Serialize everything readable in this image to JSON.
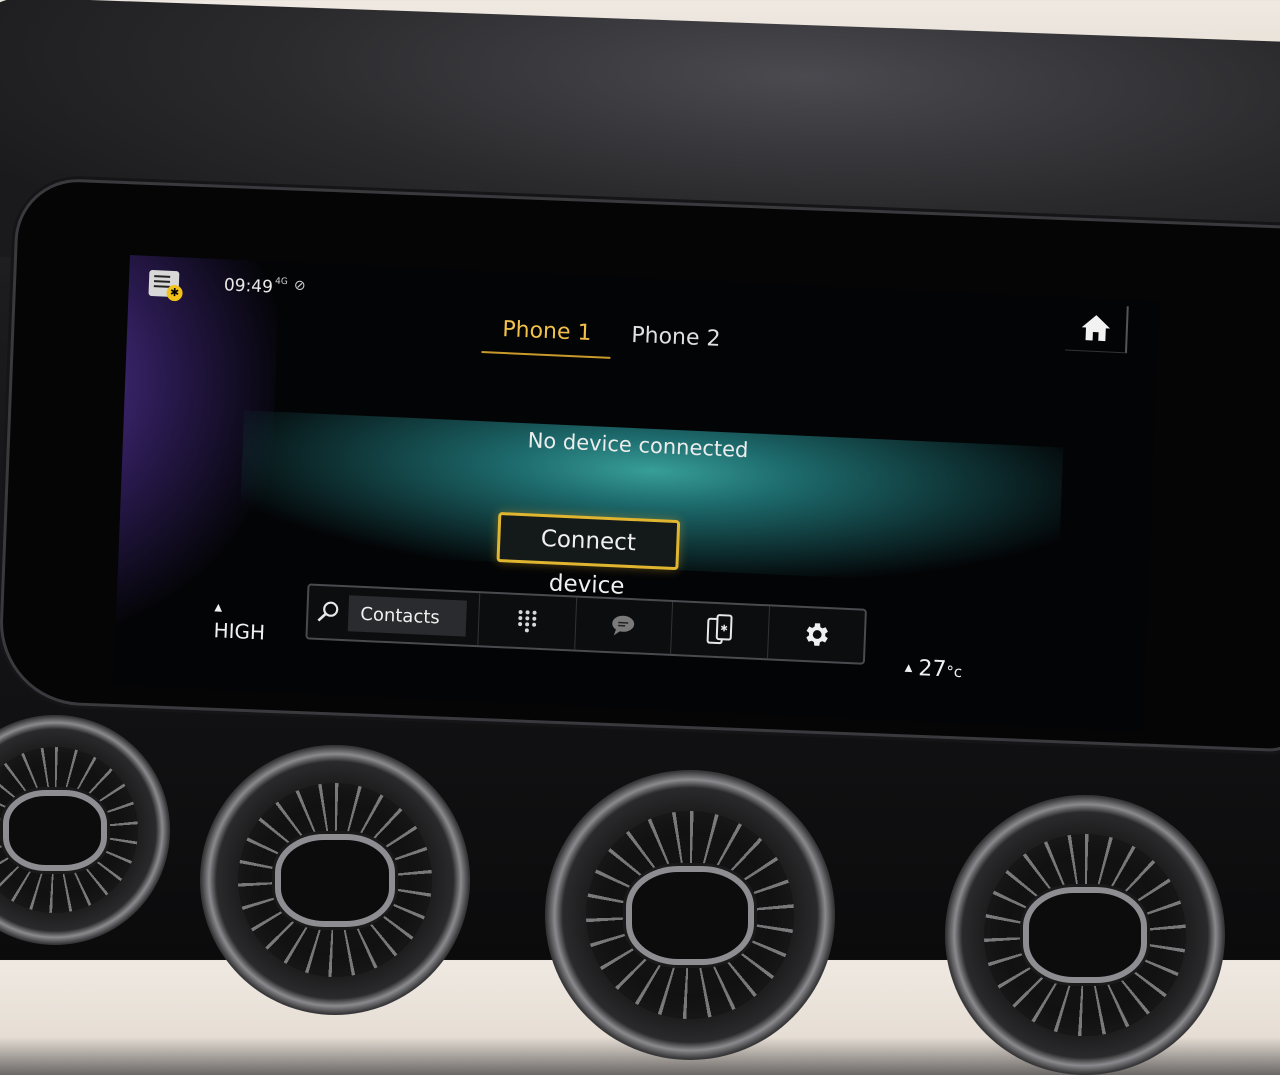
{
  "status": {
    "time": "09:49",
    "network": "4G",
    "notification_icon": "notifications-icon",
    "mute_icon": "mute-icon"
  },
  "tabs": [
    {
      "label": "Phone 1",
      "active": true
    },
    {
      "label": "Phone 2",
      "active": false
    }
  ],
  "main": {
    "message": "No device connected",
    "connect_label": "Connect device"
  },
  "toolbar": {
    "search_label": "Contacts",
    "items": [
      "search-icon",
      "keypad-icon",
      "messages-icon",
      "device-icon",
      "settings-icon"
    ]
  },
  "climate": {
    "fan_label": "HIGH",
    "temperature": "27",
    "temperature_unit": "°c"
  },
  "colors": {
    "accent": "#f2c14a",
    "button_border": "#e0b530",
    "glow": "#3aa6a0"
  }
}
